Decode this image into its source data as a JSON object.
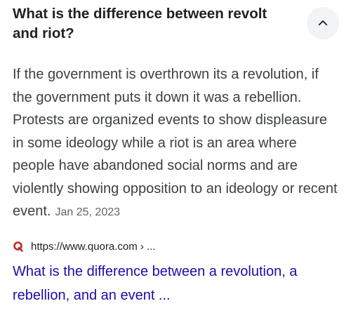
{
  "question": {
    "title": "What is the difference between revolt and riot?"
  },
  "answer": {
    "text": "If the government is overthrown its a revolution, if the government puts it down it was a rebellion. Protests are organized events to show displeasure in some ideology while a riot is an area where people have abandoned social norms and are violently showing opposition to an ideology or recent event.",
    "date": "Jan 25, 2023"
  },
  "source": {
    "url": "https://www.quora.com › ...",
    "favicon_icon": "quora-logo-icon",
    "favicon_color": "#b92b27"
  },
  "result": {
    "title": "What is the difference between a revolution, a rebellion, and an event ..."
  },
  "controls": {
    "collapse_icon": "chevron-up-icon"
  }
}
